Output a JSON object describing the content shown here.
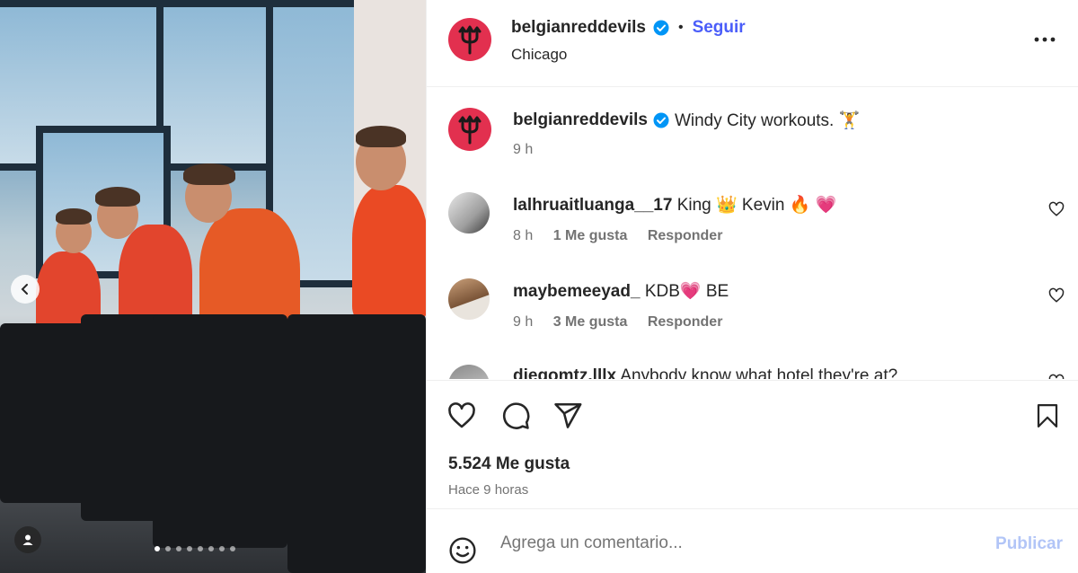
{
  "post": {
    "author": "belgianreddevils",
    "follow_label": "Seguir",
    "separator": "•",
    "location": "Chicago",
    "caption": "Windy City workouts. 🏋",
    "caption_age": "9 h",
    "likes": "5.524 Me gusta",
    "timestamp": "Hace 9 horas",
    "carousel_count": 8,
    "carousel_active": 0
  },
  "comments": [
    {
      "user": "lalhruaitluanga__17",
      "text": "King 👑 Kevin 🔥 💗",
      "age": "8 h",
      "likes": "1 Me gusta",
      "reply": "Responder"
    },
    {
      "user": "maybemeeyad_",
      "text": "KDB💗 BE",
      "age": "9 h",
      "likes": "3 Me gusta",
      "reply": "Responder"
    },
    {
      "user": "diegomtz.lllx",
      "text": "Anybody know what hotel they're at?",
      "age": "",
      "likes": "",
      "reply": ""
    }
  ],
  "composer": {
    "placeholder": "Agrega un comentario...",
    "publish_label": "Publicar"
  },
  "icons": {
    "like": "heart-icon",
    "comment": "comment-icon",
    "share": "send-icon",
    "save": "bookmark-icon",
    "emoji": "emoji-icon",
    "more": "more-options-icon",
    "verified": "verified-badge-icon",
    "carousel_prev": "chevron-left-icon",
    "tags": "user-tag-icon"
  },
  "colors": {
    "brand_red": "#e2304f",
    "link_blue": "#4a5df9",
    "verified_blue": "#0095f6",
    "publish_disabled": "#b2c5f7"
  }
}
